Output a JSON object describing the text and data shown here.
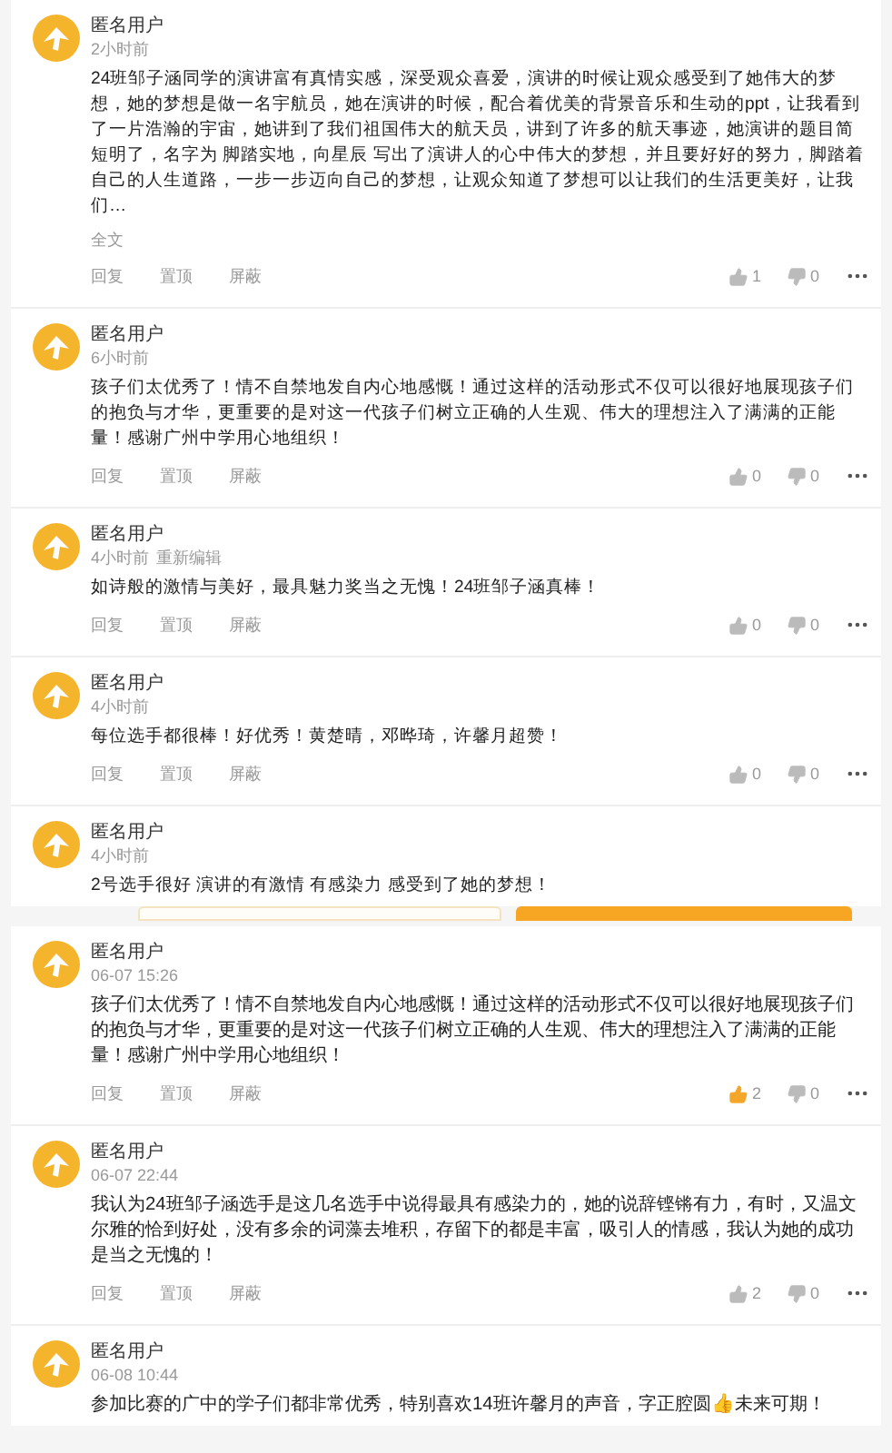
{
  "screens": [
    {
      "comments": [
        {
          "user": "匿名用户",
          "time": "2小时前",
          "body": "24班邹子涵同学的演讲富有真情实感，深受观众喜爱，演讲的时候让观众感受到了她伟大的梦想，她的梦想是做一名宇航员，她在演讲的时候，配合着优美的背景音乐和生动的ppt，让我看到了一片浩瀚的宇宙，她讲到了我们祖国伟大的航天员，讲到了许多的航天事迹，她演讲的题目简短明了，名字为 脚踏实地，向星辰 写出了演讲人的心中伟大的梦想，并且要好好的努力，脚踏着自己的人生道路，一步一步迈向自己的梦想，让观众知道了梦想可以让我们的生活更美好，让我们…",
          "more": "全文",
          "actions": [
            "回复",
            "置顶",
            "屏蔽"
          ],
          "likes": "1",
          "dislikes": "0",
          "liked": false
        },
        {
          "user": "匿名用户",
          "time": "6小时前",
          "body": "孩子们太优秀了！情不自禁地发自内心地感慨！通过这样的活动形式不仅可以很好地展现孩子们的抱负与才华，更重要的是对这一代孩子们树立正确的人生观、伟大的理想注入了满满的正能量！感谢广州中学用心地组织！",
          "actions": [
            "回复",
            "置顶",
            "屏蔽"
          ],
          "likes": "0",
          "dislikes": "0",
          "liked": false
        },
        {
          "user": "匿名用户",
          "time": "4小时前",
          "edited": "重新编辑",
          "body": "如诗般的激情与美好，最具魅力奖当之无愧！24班邹子涵真棒！",
          "actions": [
            "回复",
            "置顶",
            "屏蔽"
          ],
          "likes": "0",
          "dislikes": "0",
          "liked": false
        },
        {
          "user": "匿名用户",
          "time": "4小时前",
          "body": "每位选手都很棒！好优秀！黄楚晴，邓晔琦，许馨月超赞！",
          "actions": [
            "回复",
            "置顶",
            "屏蔽"
          ],
          "likes": "0",
          "dislikes": "0",
          "liked": false
        },
        {
          "user": "匿名用户",
          "time": "4小时前",
          "body": "2号选手很好 演讲的有激情 有感染力 感受到了她的梦想！"
        }
      ],
      "composer": {
        "kind": "bar"
      }
    },
    {
      "comments": [
        {
          "user": "匿名用户",
          "time": "06-07 15:26",
          "body": "孩子们太优秀了！情不自禁地发自内心地感慨！通过这样的活动形式不仅可以很好地展现孩子们的抱负与才华，更重要的是对这一代孩子们树立正确的人生观、伟大的理想注入了满满的正能量！感谢广州中学用心地组织！",
          "actions": [
            "回复",
            "置顶",
            "屏蔽"
          ],
          "likes": "2",
          "dislikes": "0",
          "liked": true
        },
        {
          "user": "匿名用户",
          "time": "06-07 22:44",
          "body": "我认为24班邹子涵选手是这几名选手中说得最具有感染力的，她的说辞铿锵有力，有时，又温文尔雅的恰到好处，没有多余的词藻去堆积，存留下的都是丰富，吸引人的情感，我认为她的成功是当之无愧的！",
          "actions": [
            "回复",
            "置顶",
            "屏蔽"
          ],
          "likes": "2",
          "dislikes": "0",
          "liked": false
        },
        {
          "user": "匿名用户",
          "time": "06-08 10:44",
          "body": "参加比赛的广中的学子们都非常优秀，特别喜欢14班许馨月的声音，字正腔圆👍未来可期！"
        }
      ]
    }
  ]
}
